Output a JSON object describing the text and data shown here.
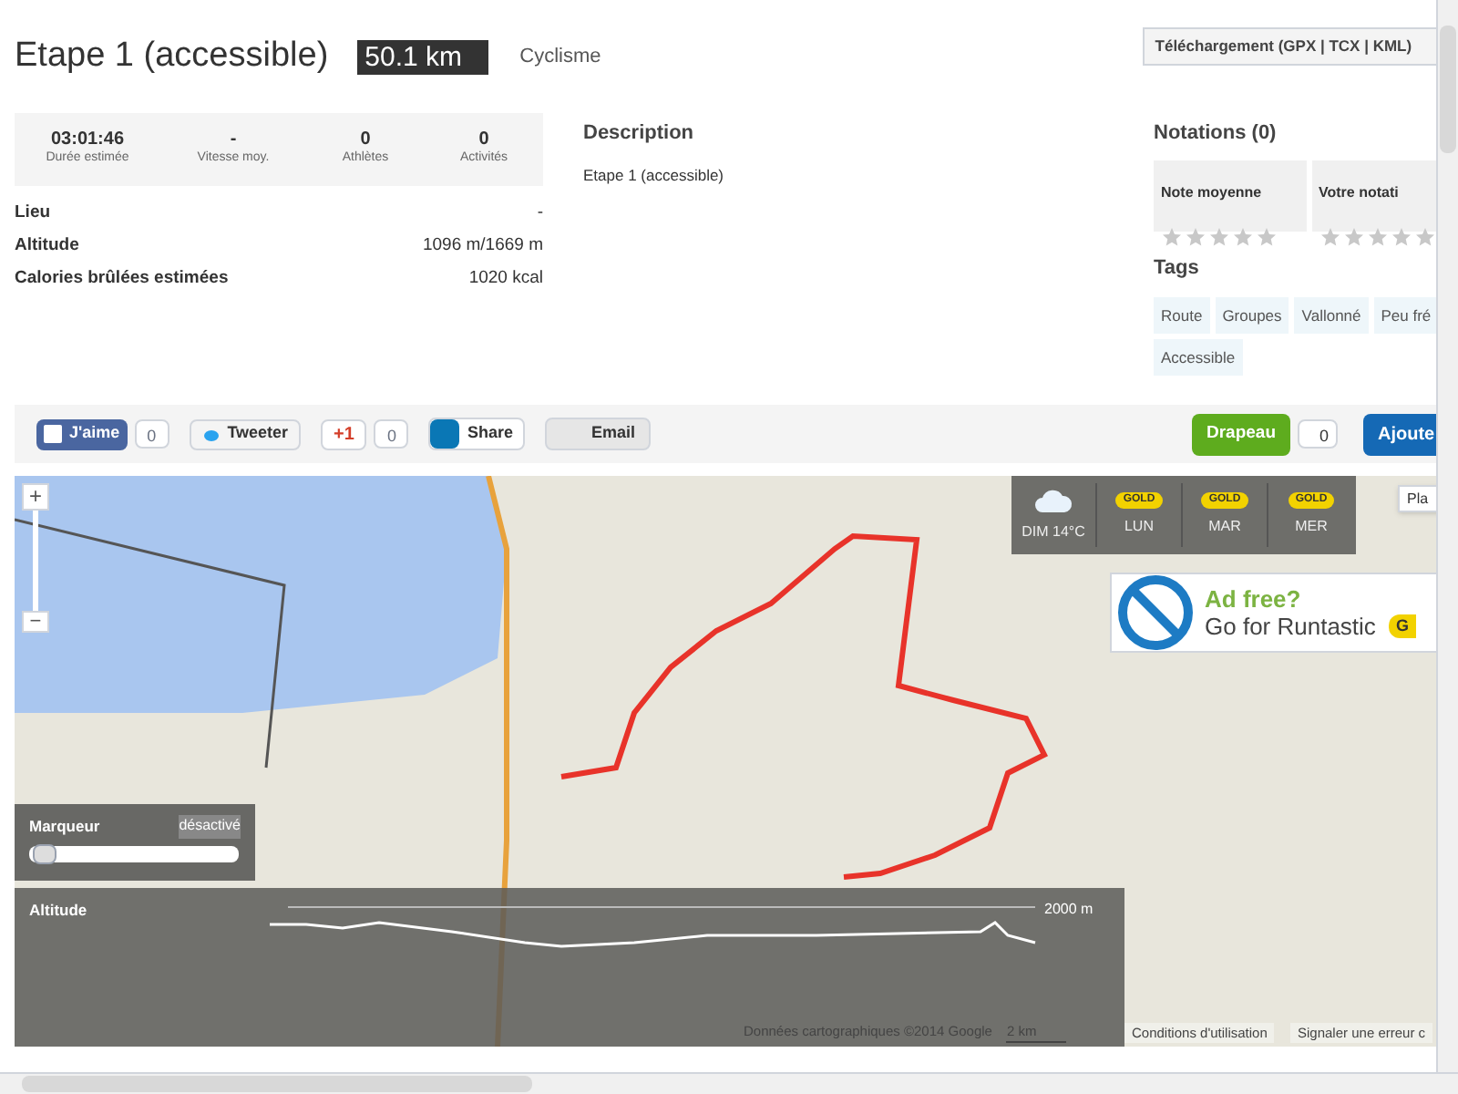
{
  "header": {
    "title": "Etape 1 (accessible)",
    "distance": "50.1 km",
    "sport": "Cyclisme",
    "download": "Téléchargement (GPX | TCX | KML)"
  },
  "stats": [
    {
      "value": "03:01:46",
      "label": "Durée estimée"
    },
    {
      "value": "-",
      "label": "Vitesse moy."
    },
    {
      "value": "0",
      "label": "Athlètes"
    },
    {
      "value": "0",
      "label": "Activités"
    }
  ],
  "details": [
    {
      "label": "Lieu",
      "value": "-"
    },
    {
      "label": "Altitude",
      "value": "1096 m/1669 m"
    },
    {
      "label": "Calories brûlées estimées",
      "value": "1020 kcal"
    }
  ],
  "description": {
    "heading": "Description",
    "text": "Etape 1 (accessible)"
  },
  "ratings": {
    "heading": "Notations (0)",
    "boxes": [
      {
        "label": "Note moyenne",
        "stars": 0
      },
      {
        "label": "Votre notati",
        "stars": 0
      }
    ]
  },
  "tags": {
    "heading": "Tags",
    "items": [
      "Route",
      "Groupes",
      "Vallonné",
      "Peu fré",
      "Accessible"
    ]
  },
  "social": [
    {
      "kind": "facebook",
      "label": "J'aime",
      "count": "0"
    },
    {
      "kind": "twitter",
      "label": "Tweeter"
    },
    {
      "kind": "gplus",
      "label": "+1",
      "count": "0"
    },
    {
      "kind": "linkedin",
      "label": "Share"
    },
    {
      "kind": "email",
      "label": "Email"
    }
  ],
  "actions": {
    "flag": "Drapeau",
    "flag_count": "0",
    "add": "Ajoute"
  },
  "map": {
    "zoom_in": "+",
    "zoom_out": "−",
    "map_type": "Pla",
    "weather": [
      {
        "kind": "weather",
        "label": "DIM 14°C"
      },
      {
        "kind": "gold",
        "badge": "GOLD",
        "label": "LUN"
      },
      {
        "kind": "gold",
        "badge": "GOLD",
        "label": "MAR"
      },
      {
        "kind": "gold",
        "badge": "GOLD",
        "label": "MER"
      }
    ],
    "ad": {
      "title": "Ad free?",
      "subtitle": "Go for Runtastic",
      "button": "G"
    },
    "marker": {
      "label": "Marqueur",
      "status": "désactivé",
      "level": 0.02
    },
    "altitude": {
      "label": "Altitude",
      "scale": "2000 m"
    },
    "attribution": "Données cartographiques ©2014 Google",
    "scale": "2 km",
    "terms": "Conditions d'utilisation",
    "report": "Signaler une erreur c"
  }
}
